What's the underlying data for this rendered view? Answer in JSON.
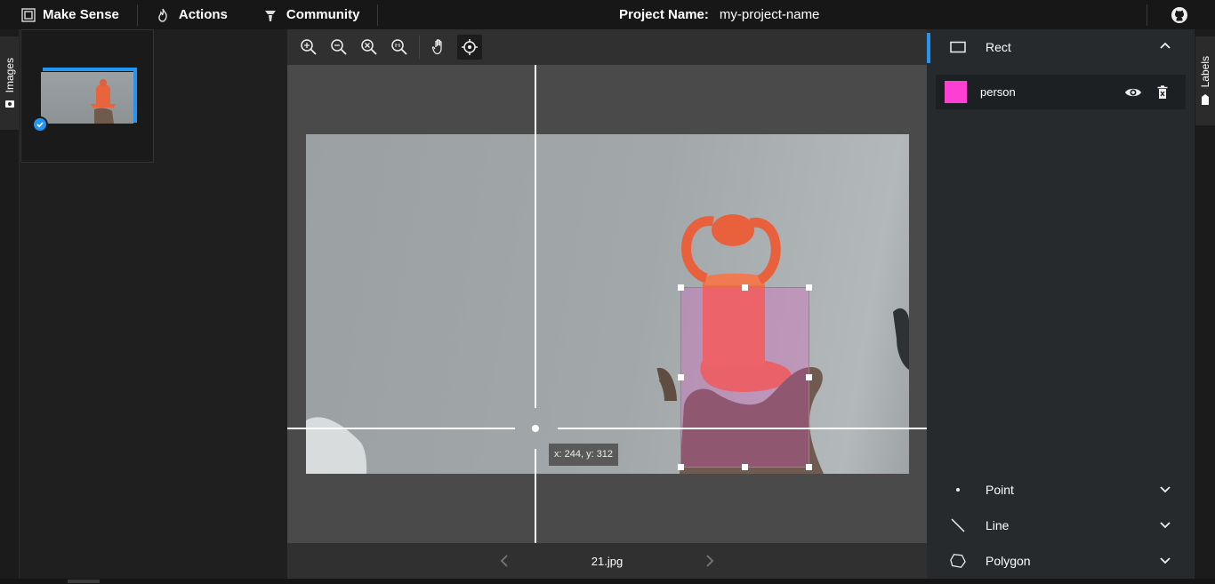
{
  "app": {
    "title": "Make Sense",
    "nav": [
      {
        "label": "Actions",
        "icon": "fire-icon"
      },
      {
        "label": "Community",
        "icon": "community-icon"
      }
    ],
    "project_label": "Project Name:",
    "project_name": "my-project-name",
    "github_icon": "github-icon"
  },
  "left_tab": {
    "label": "Images",
    "icon": "camera-icon"
  },
  "right_tab": {
    "label": "Labels",
    "icon": "label-tag-icon"
  },
  "toolbar": {
    "tools": [
      "zoom-in-icon",
      "zoom-out-icon",
      "zoom-fit-icon",
      "zoom-reset-icon",
      "hand-icon",
      "crosshair-icon"
    ],
    "active_tool": "crosshair-icon"
  },
  "canvas": {
    "cursor_readout": "x: 244, y: 312",
    "filename": "21.jpg"
  },
  "labels_panel": {
    "rect": {
      "title": "Rect",
      "expanded": true
    },
    "label_items": [
      {
        "name": "person",
        "color": "#ff3fd4"
      }
    ],
    "point": {
      "title": "Point"
    },
    "line": {
      "title": "Line"
    },
    "polygon": {
      "title": "Polygon"
    }
  },
  "colors": {
    "accent": "#2196f3",
    "label": "#ff3fd4"
  }
}
